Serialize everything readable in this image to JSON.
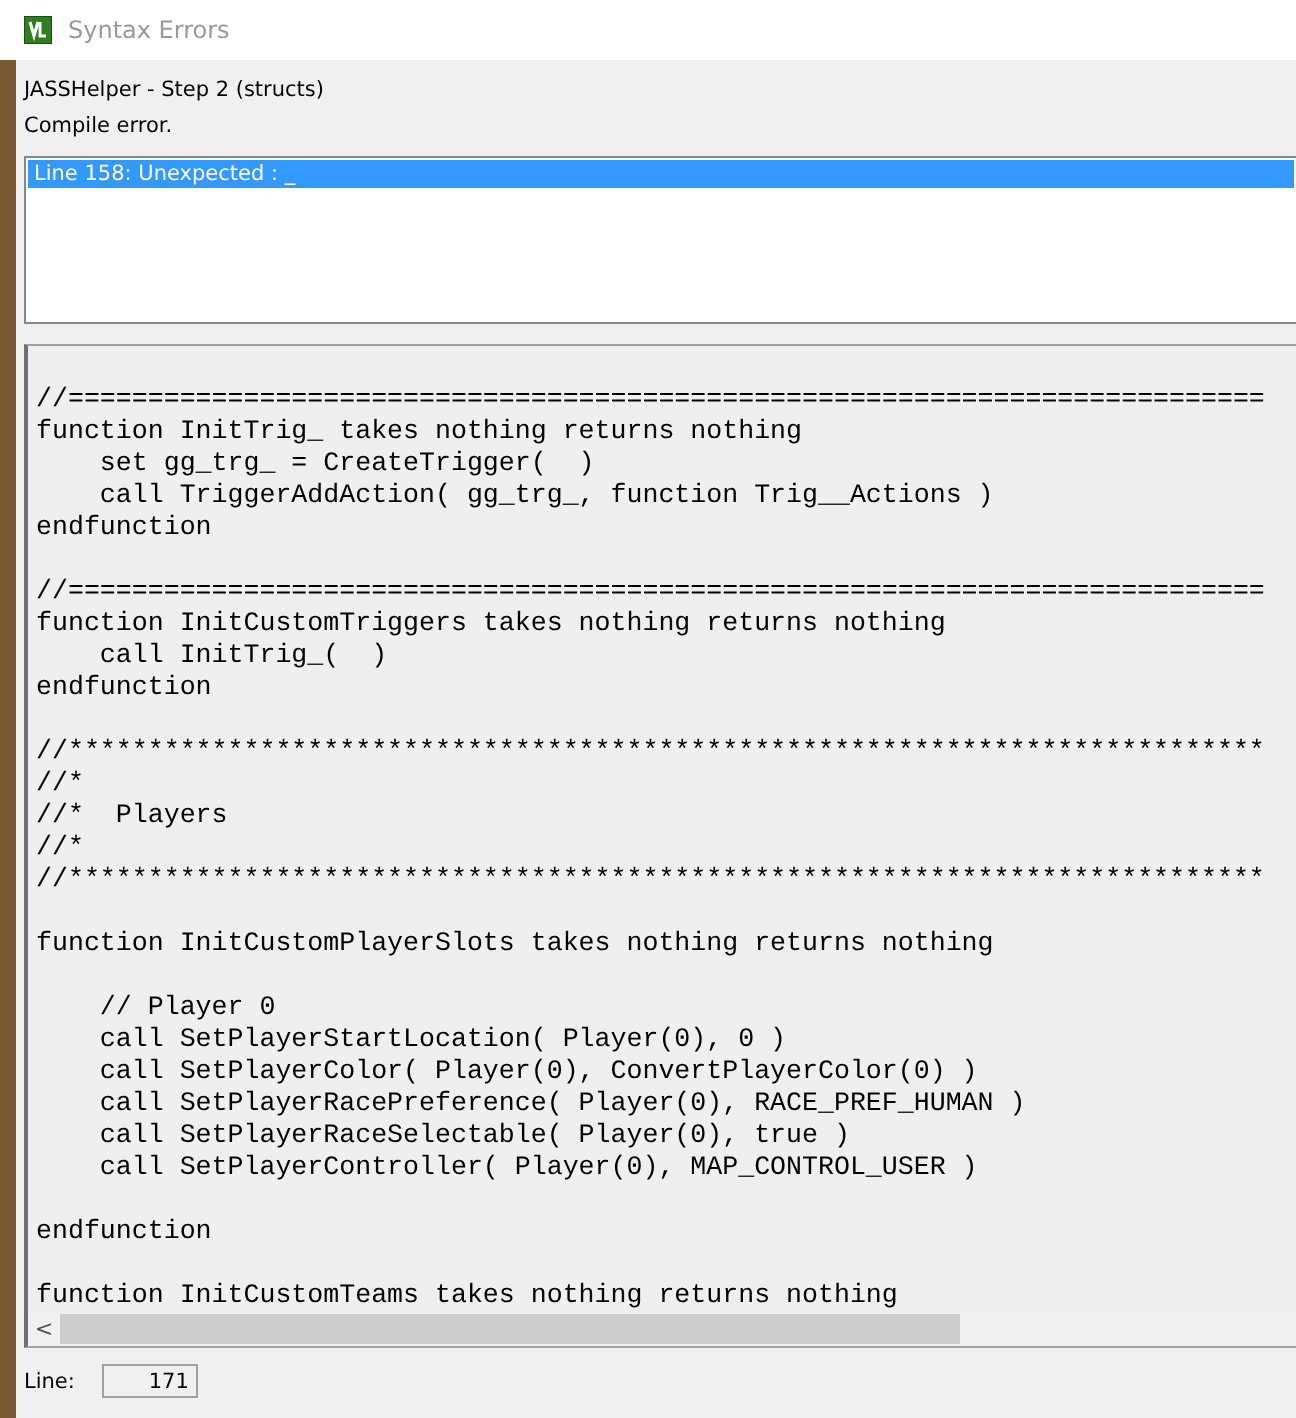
{
  "window": {
    "title": "Syntax Errors"
  },
  "header": {
    "step": "JASSHelper - Step 2 (structs)",
    "message": "Compile error."
  },
  "errors": [
    {
      "text": "Line 158: Unexpected : _",
      "selected": true
    }
  ],
  "code_blocks": [
    [
      "//===========================================================================",
      "function InitTrig_ takes nothing returns nothing",
      "    set gg_trg_ = CreateTrigger(  )",
      "    call TriggerAddAction( gg_trg_, function Trig__Actions )",
      "endfunction"
    ],
    [
      "//===========================================================================",
      "function InitCustomTriggers takes nothing returns nothing",
      "    call InitTrig_(  )",
      "endfunction"
    ],
    [
      "//***************************************************************************",
      "//*",
      "//*  Players",
      "//*",
      "//***************************************************************************"
    ],
    [
      "function InitCustomPlayerSlots takes nothing returns nothing"
    ],
    [
      "    // Player 0",
      "    call SetPlayerStartLocation( Player(0), 0 )",
      "    call SetPlayerColor( Player(0), ConvertPlayerColor(0) )",
      "    call SetPlayerRacePreference( Player(0), RACE_PREF_HUMAN )",
      "    call SetPlayerRaceSelectable( Player(0), true )",
      "    call SetPlayerController( Player(0), MAP_CONTROL_USER )"
    ],
    [
      "endfunction"
    ],
    [
      "function InitCustomTeams takes nothing returns nothing"
    ]
  ],
  "scroll_left": "<",
  "status": {
    "label": "Line:",
    "value": "171"
  }
}
